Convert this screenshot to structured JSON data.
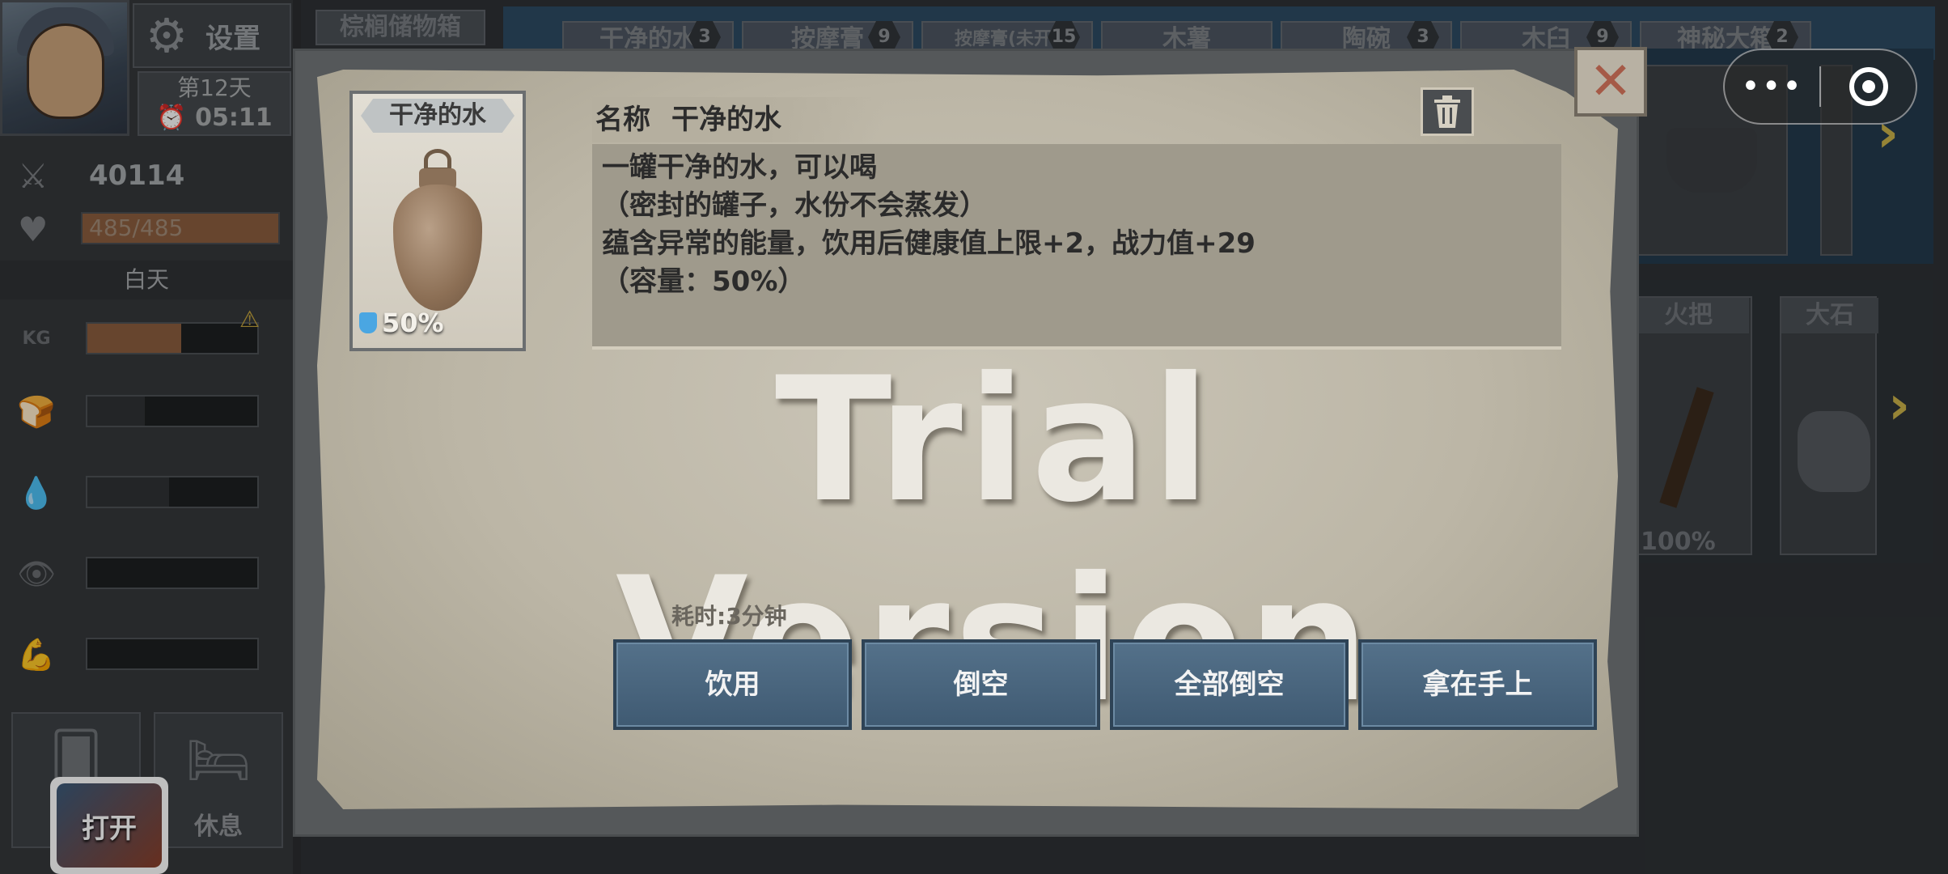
{
  "sidebar": {
    "settings_label": "设置",
    "day": "第12天",
    "time": "05:11",
    "power": "40114",
    "hp": "485/485",
    "hp_fraction": 1.0,
    "daytime": "白天",
    "needs": [
      {
        "icon": "weight-icon",
        "fill": 0.55,
        "color": "#8a5c3e",
        "warning": true
      },
      {
        "icon": "bread-icon",
        "fill": 0.34,
        "color": "#2f3235"
      },
      {
        "icon": "water-drop-icon",
        "fill": 0.48,
        "color": "#2f3235"
      },
      {
        "icon": "eye-icon",
        "fill": 0.0,
        "color": "#2f3235"
      },
      {
        "icon": "muscle-icon",
        "fill": 0.0,
        "color": "#2f3235"
      }
    ],
    "rest_label": "休息",
    "open_label": "打开"
  },
  "background": {
    "storage_title": "棕榈储物箱",
    "tabs": [
      {
        "label": "干净的水",
        "count": "3"
      },
      {
        "label": "按摩膏",
        "count": "9"
      },
      {
        "label": "按摩膏(未开)",
        "count": "15"
      },
      {
        "label": "木薯",
        "count": ""
      },
      {
        "label": "陶碗",
        "count": "3"
      },
      {
        "label": "木臼",
        "count": "9"
      },
      {
        "label": "神秘大箱",
        "count": "2"
      }
    ],
    "torch_label": "火把",
    "stone_label": "大石",
    "torch_percent": "100%"
  },
  "dialog": {
    "item_name": "干净的水",
    "name_key": "名称",
    "capacity_badge": "50%",
    "description": [
      "一罐干净的水，可以喝",
      "（密封的罐子，水份不会蒸发）",
      "蕴含异常的能量，饮用后健康值上限+2，战力值+29",
      "（容量：50%）"
    ],
    "watermark": "Trial Version",
    "time_cost": "耗时:3分钟",
    "actions": [
      "饮用",
      "倒空",
      "全部倒空",
      "拿在手上"
    ]
  },
  "colors": {
    "action_button": "#4a6680",
    "parchment": "#c4bfb0",
    "close_x": "#a55a47"
  }
}
